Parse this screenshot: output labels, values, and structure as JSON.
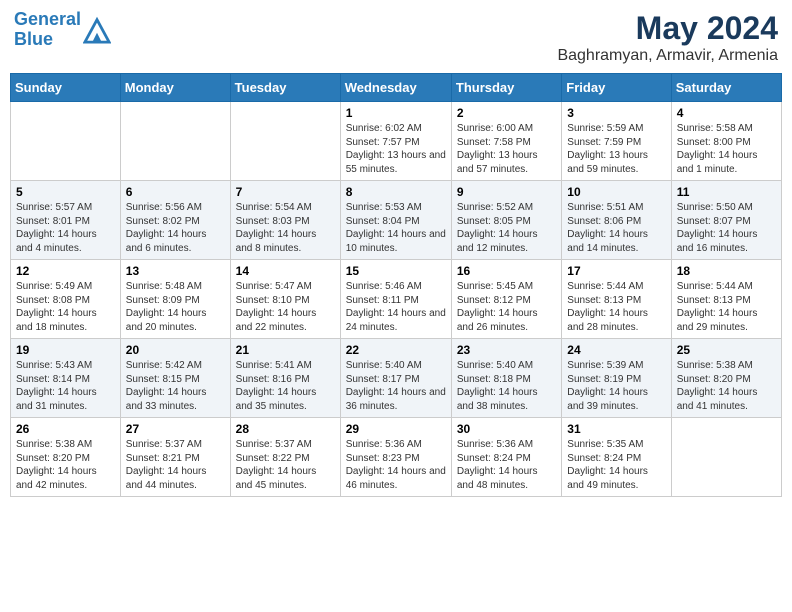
{
  "header": {
    "logo_line1": "General",
    "logo_line2": "Blue",
    "month": "May 2024",
    "location": "Baghramyan, Armavir, Armenia"
  },
  "weekdays": [
    "Sunday",
    "Monday",
    "Tuesday",
    "Wednesday",
    "Thursday",
    "Friday",
    "Saturday"
  ],
  "weeks": [
    [
      {
        "day": "",
        "sunrise": "",
        "sunset": "",
        "daylight": ""
      },
      {
        "day": "",
        "sunrise": "",
        "sunset": "",
        "daylight": ""
      },
      {
        "day": "",
        "sunrise": "",
        "sunset": "",
        "daylight": ""
      },
      {
        "day": "1",
        "sunrise": "Sunrise: 6:02 AM",
        "sunset": "Sunset: 7:57 PM",
        "daylight": "Daylight: 13 hours and 55 minutes."
      },
      {
        "day": "2",
        "sunrise": "Sunrise: 6:00 AM",
        "sunset": "Sunset: 7:58 PM",
        "daylight": "Daylight: 13 hours and 57 minutes."
      },
      {
        "day": "3",
        "sunrise": "Sunrise: 5:59 AM",
        "sunset": "Sunset: 7:59 PM",
        "daylight": "Daylight: 13 hours and 59 minutes."
      },
      {
        "day": "4",
        "sunrise": "Sunrise: 5:58 AM",
        "sunset": "Sunset: 8:00 PM",
        "daylight": "Daylight: 14 hours and 1 minute."
      }
    ],
    [
      {
        "day": "5",
        "sunrise": "Sunrise: 5:57 AM",
        "sunset": "Sunset: 8:01 PM",
        "daylight": "Daylight: 14 hours and 4 minutes."
      },
      {
        "day": "6",
        "sunrise": "Sunrise: 5:56 AM",
        "sunset": "Sunset: 8:02 PM",
        "daylight": "Daylight: 14 hours and 6 minutes."
      },
      {
        "day": "7",
        "sunrise": "Sunrise: 5:54 AM",
        "sunset": "Sunset: 8:03 PM",
        "daylight": "Daylight: 14 hours and 8 minutes."
      },
      {
        "day": "8",
        "sunrise": "Sunrise: 5:53 AM",
        "sunset": "Sunset: 8:04 PM",
        "daylight": "Daylight: 14 hours and 10 minutes."
      },
      {
        "day": "9",
        "sunrise": "Sunrise: 5:52 AM",
        "sunset": "Sunset: 8:05 PM",
        "daylight": "Daylight: 14 hours and 12 minutes."
      },
      {
        "day": "10",
        "sunrise": "Sunrise: 5:51 AM",
        "sunset": "Sunset: 8:06 PM",
        "daylight": "Daylight: 14 hours and 14 minutes."
      },
      {
        "day": "11",
        "sunrise": "Sunrise: 5:50 AM",
        "sunset": "Sunset: 8:07 PM",
        "daylight": "Daylight: 14 hours and 16 minutes."
      }
    ],
    [
      {
        "day": "12",
        "sunrise": "Sunrise: 5:49 AM",
        "sunset": "Sunset: 8:08 PM",
        "daylight": "Daylight: 14 hours and 18 minutes."
      },
      {
        "day": "13",
        "sunrise": "Sunrise: 5:48 AM",
        "sunset": "Sunset: 8:09 PM",
        "daylight": "Daylight: 14 hours and 20 minutes."
      },
      {
        "day": "14",
        "sunrise": "Sunrise: 5:47 AM",
        "sunset": "Sunset: 8:10 PM",
        "daylight": "Daylight: 14 hours and 22 minutes."
      },
      {
        "day": "15",
        "sunrise": "Sunrise: 5:46 AM",
        "sunset": "Sunset: 8:11 PM",
        "daylight": "Daylight: 14 hours and 24 minutes."
      },
      {
        "day": "16",
        "sunrise": "Sunrise: 5:45 AM",
        "sunset": "Sunset: 8:12 PM",
        "daylight": "Daylight: 14 hours and 26 minutes."
      },
      {
        "day": "17",
        "sunrise": "Sunrise: 5:44 AM",
        "sunset": "Sunset: 8:13 PM",
        "daylight": "Daylight: 14 hours and 28 minutes."
      },
      {
        "day": "18",
        "sunrise": "Sunrise: 5:44 AM",
        "sunset": "Sunset: 8:13 PM",
        "daylight": "Daylight: 14 hours and 29 minutes."
      }
    ],
    [
      {
        "day": "19",
        "sunrise": "Sunrise: 5:43 AM",
        "sunset": "Sunset: 8:14 PM",
        "daylight": "Daylight: 14 hours and 31 minutes."
      },
      {
        "day": "20",
        "sunrise": "Sunrise: 5:42 AM",
        "sunset": "Sunset: 8:15 PM",
        "daylight": "Daylight: 14 hours and 33 minutes."
      },
      {
        "day": "21",
        "sunrise": "Sunrise: 5:41 AM",
        "sunset": "Sunset: 8:16 PM",
        "daylight": "Daylight: 14 hours and 35 minutes."
      },
      {
        "day": "22",
        "sunrise": "Sunrise: 5:40 AM",
        "sunset": "Sunset: 8:17 PM",
        "daylight": "Daylight: 14 hours and 36 minutes."
      },
      {
        "day": "23",
        "sunrise": "Sunrise: 5:40 AM",
        "sunset": "Sunset: 8:18 PM",
        "daylight": "Daylight: 14 hours and 38 minutes."
      },
      {
        "day": "24",
        "sunrise": "Sunrise: 5:39 AM",
        "sunset": "Sunset: 8:19 PM",
        "daylight": "Daylight: 14 hours and 39 minutes."
      },
      {
        "day": "25",
        "sunrise": "Sunrise: 5:38 AM",
        "sunset": "Sunset: 8:20 PM",
        "daylight": "Daylight: 14 hours and 41 minutes."
      }
    ],
    [
      {
        "day": "26",
        "sunrise": "Sunrise: 5:38 AM",
        "sunset": "Sunset: 8:20 PM",
        "daylight": "Daylight: 14 hours and 42 minutes."
      },
      {
        "day": "27",
        "sunrise": "Sunrise: 5:37 AM",
        "sunset": "Sunset: 8:21 PM",
        "daylight": "Daylight: 14 hours and 44 minutes."
      },
      {
        "day": "28",
        "sunrise": "Sunrise: 5:37 AM",
        "sunset": "Sunset: 8:22 PM",
        "daylight": "Daylight: 14 hours and 45 minutes."
      },
      {
        "day": "29",
        "sunrise": "Sunrise: 5:36 AM",
        "sunset": "Sunset: 8:23 PM",
        "daylight": "Daylight: 14 hours and 46 minutes."
      },
      {
        "day": "30",
        "sunrise": "Sunrise: 5:36 AM",
        "sunset": "Sunset: 8:24 PM",
        "daylight": "Daylight: 14 hours and 48 minutes."
      },
      {
        "day": "31",
        "sunrise": "Sunrise: 5:35 AM",
        "sunset": "Sunset: 8:24 PM",
        "daylight": "Daylight: 14 hours and 49 minutes."
      },
      {
        "day": "",
        "sunrise": "",
        "sunset": "",
        "daylight": ""
      }
    ]
  ]
}
